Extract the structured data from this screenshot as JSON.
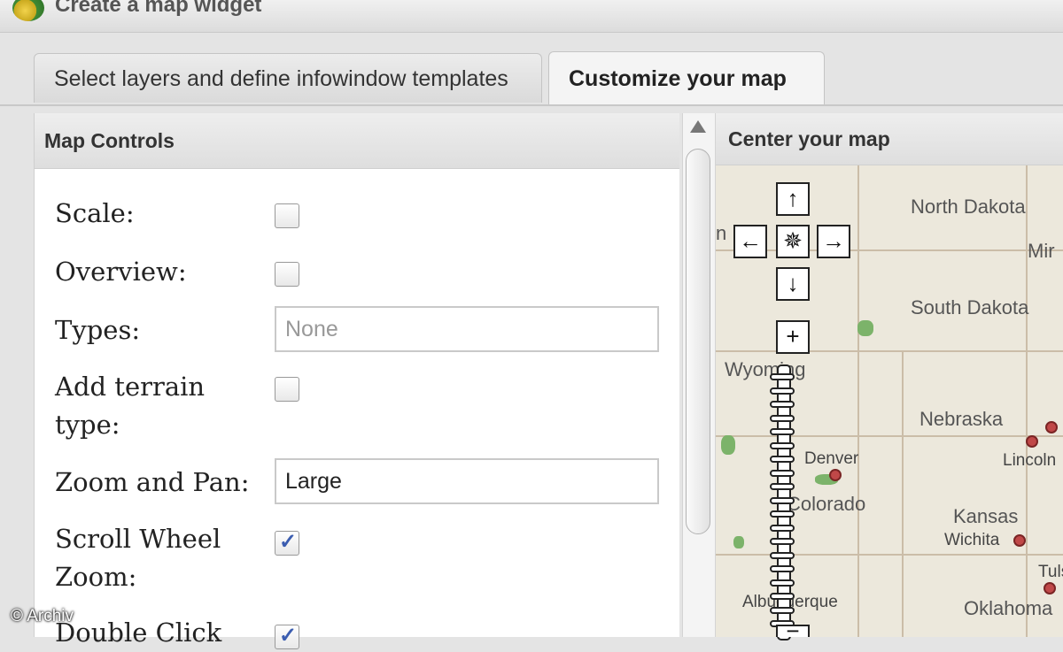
{
  "window": {
    "title": "Create a map widget",
    "logo_icon": "globe-icon"
  },
  "tabs": [
    {
      "label": "Select layers and define infowindow templates",
      "active": false
    },
    {
      "label": "Customize your map",
      "active": true
    }
  ],
  "map_controls": {
    "heading": "Map Controls",
    "fields": {
      "scale": {
        "label": "Scale:",
        "checked": false
      },
      "overview": {
        "label": "Overview:",
        "checked": false
      },
      "types": {
        "label": "Types:",
        "placeholder": "None",
        "value": ""
      },
      "add_terrain": {
        "label_line1": "Add terrain",
        "label_line2": "type:",
        "checked": false
      },
      "zoom_pan": {
        "label": "Zoom and Pan:",
        "value": "Large"
      },
      "scroll_wheel": {
        "label_line1": "Scroll Wheel",
        "label_line2": "Zoom:",
        "checked": true
      },
      "double_click": {
        "label_line1": "Double Click",
        "checked": true
      }
    }
  },
  "center_map": {
    "heading": "Center your map",
    "controls": {
      "pan_up": "↑",
      "pan_left": "←",
      "pan_center": "✵",
      "pan_right": "→",
      "pan_down": "↓",
      "zoom_in": "+",
      "zoom_out": "−"
    },
    "states": {
      "north_dakota": "North Dakota",
      "south_dakota": "South Dakota",
      "nebraska": "Nebraska",
      "kansas": "Kansas",
      "wyoming": "Wyoming",
      "colorado": "Colorado",
      "oklahoma": "Oklahoma",
      "minnesota_partial": "Mir",
      "montana_partial": "n"
    },
    "cities": {
      "denver": "Denver",
      "lincoln": "Lincoln",
      "wichita": "Wichita",
      "tulsa": "Tulsa",
      "albuquerque": "Albuquerque"
    }
  },
  "watermark": "© Archiv"
}
